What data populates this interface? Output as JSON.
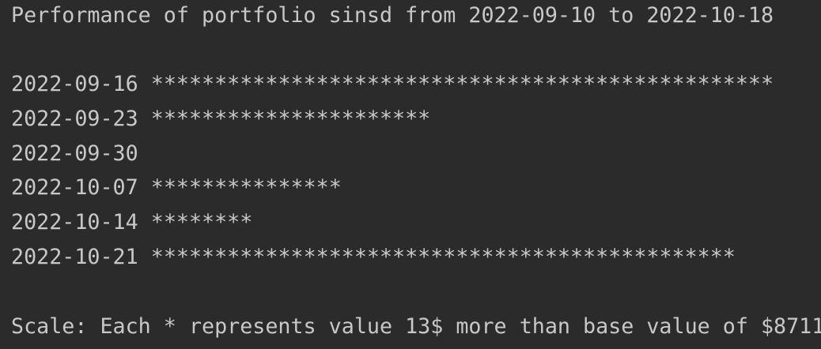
{
  "console": {
    "title": "Performance of portfolio sinsd from 2022-09-10 to 2022-10-18",
    "rows": [
      {
        "date": "2022-09-16",
        "stars": "*************************************************"
      },
      {
        "date": "2022-09-23",
        "stars": "**********************"
      },
      {
        "date": "2022-09-30",
        "stars": ""
      },
      {
        "date": "2022-10-07",
        "stars": "***************"
      },
      {
        "date": "2022-10-14",
        "stars": "********"
      },
      {
        "date": "2022-10-21",
        "stars": "**********************************************"
      }
    ],
    "scale": "Scale: Each * represents value 13$ more than base value of $8711"
  }
}
